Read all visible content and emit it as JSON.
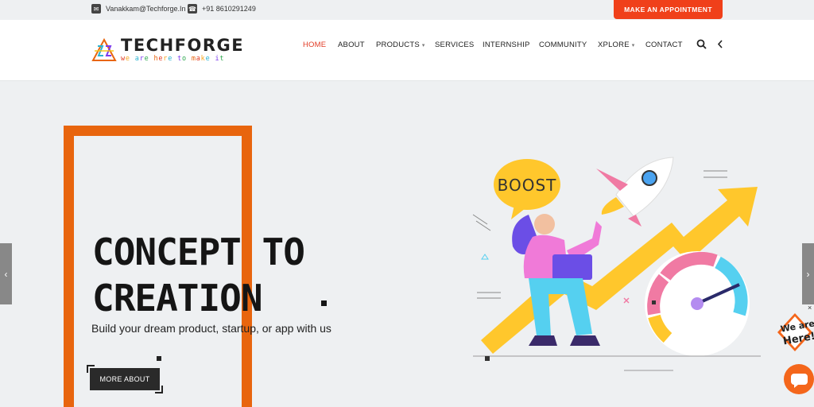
{
  "topbar": {
    "email": "Vanakkam@Techforge.In",
    "phone": "+91 8610291249",
    "appointment_label": "MAKE AN APPOINTMENT"
  },
  "brand": {
    "name": "TECHFORGE",
    "tagline": "we are here to make it"
  },
  "nav": {
    "items": [
      {
        "label": "HOME",
        "active": true,
        "dropdown": false
      },
      {
        "label": "ABOUT",
        "active": false,
        "dropdown": false
      },
      {
        "label": "PRODUCTS",
        "active": false,
        "dropdown": true
      },
      {
        "label": "SERVICES",
        "active": false,
        "dropdown": false
      },
      {
        "label": "INTERNSHIP",
        "active": false,
        "dropdown": false
      },
      {
        "label": "COMMUNITY",
        "active": false,
        "dropdown": false
      },
      {
        "label": "XPLORE",
        "active": false,
        "dropdown": true
      },
      {
        "label": "CONTACT",
        "active": false,
        "dropdown": false
      }
    ],
    "icons": [
      "search-icon",
      "chevron-left-icon"
    ]
  },
  "hero": {
    "headline_line1": "CONCEPT TO",
    "headline_line2": "CREATION",
    "subtitle": "Build your dream product, startup, or app with us",
    "button_label": "MORE ABOUT",
    "illustration_bubble": "BOOST"
  },
  "widgets": {
    "badge_text_1": "We are",
    "badge_text_2": "Here!",
    "close_label": "×"
  },
  "colors": {
    "accent": "#f0401a",
    "frame": "#e8650e",
    "active_nav": "#e23b24"
  }
}
